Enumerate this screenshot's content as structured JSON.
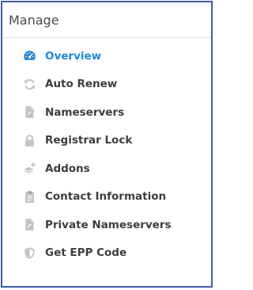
{
  "panel": {
    "title": "Manage"
  },
  "menu": {
    "items": [
      {
        "label": "Overview",
        "icon": "dashboard-gauge-icon",
        "active": true
      },
      {
        "label": "Auto Renew",
        "icon": "refresh-icon",
        "active": false
      },
      {
        "label": "Nameservers",
        "icon": "file-icon",
        "active": false
      },
      {
        "label": "Registrar Lock",
        "icon": "lock-icon",
        "active": false
      },
      {
        "label": "Addons",
        "icon": "layers-plus-icon",
        "active": false
      },
      {
        "label": "Contact Information",
        "icon": "clipboard-icon",
        "active": false
      },
      {
        "label": "Private Nameservers",
        "icon": "file-icon",
        "active": false
      },
      {
        "label": "Get EPP Code",
        "icon": "shield-icon",
        "active": false
      }
    ]
  },
  "colors": {
    "border": "#3c5ea8",
    "active": "#1f86d6",
    "text": "#3d3d3d",
    "icon": "#c4c4c4"
  }
}
